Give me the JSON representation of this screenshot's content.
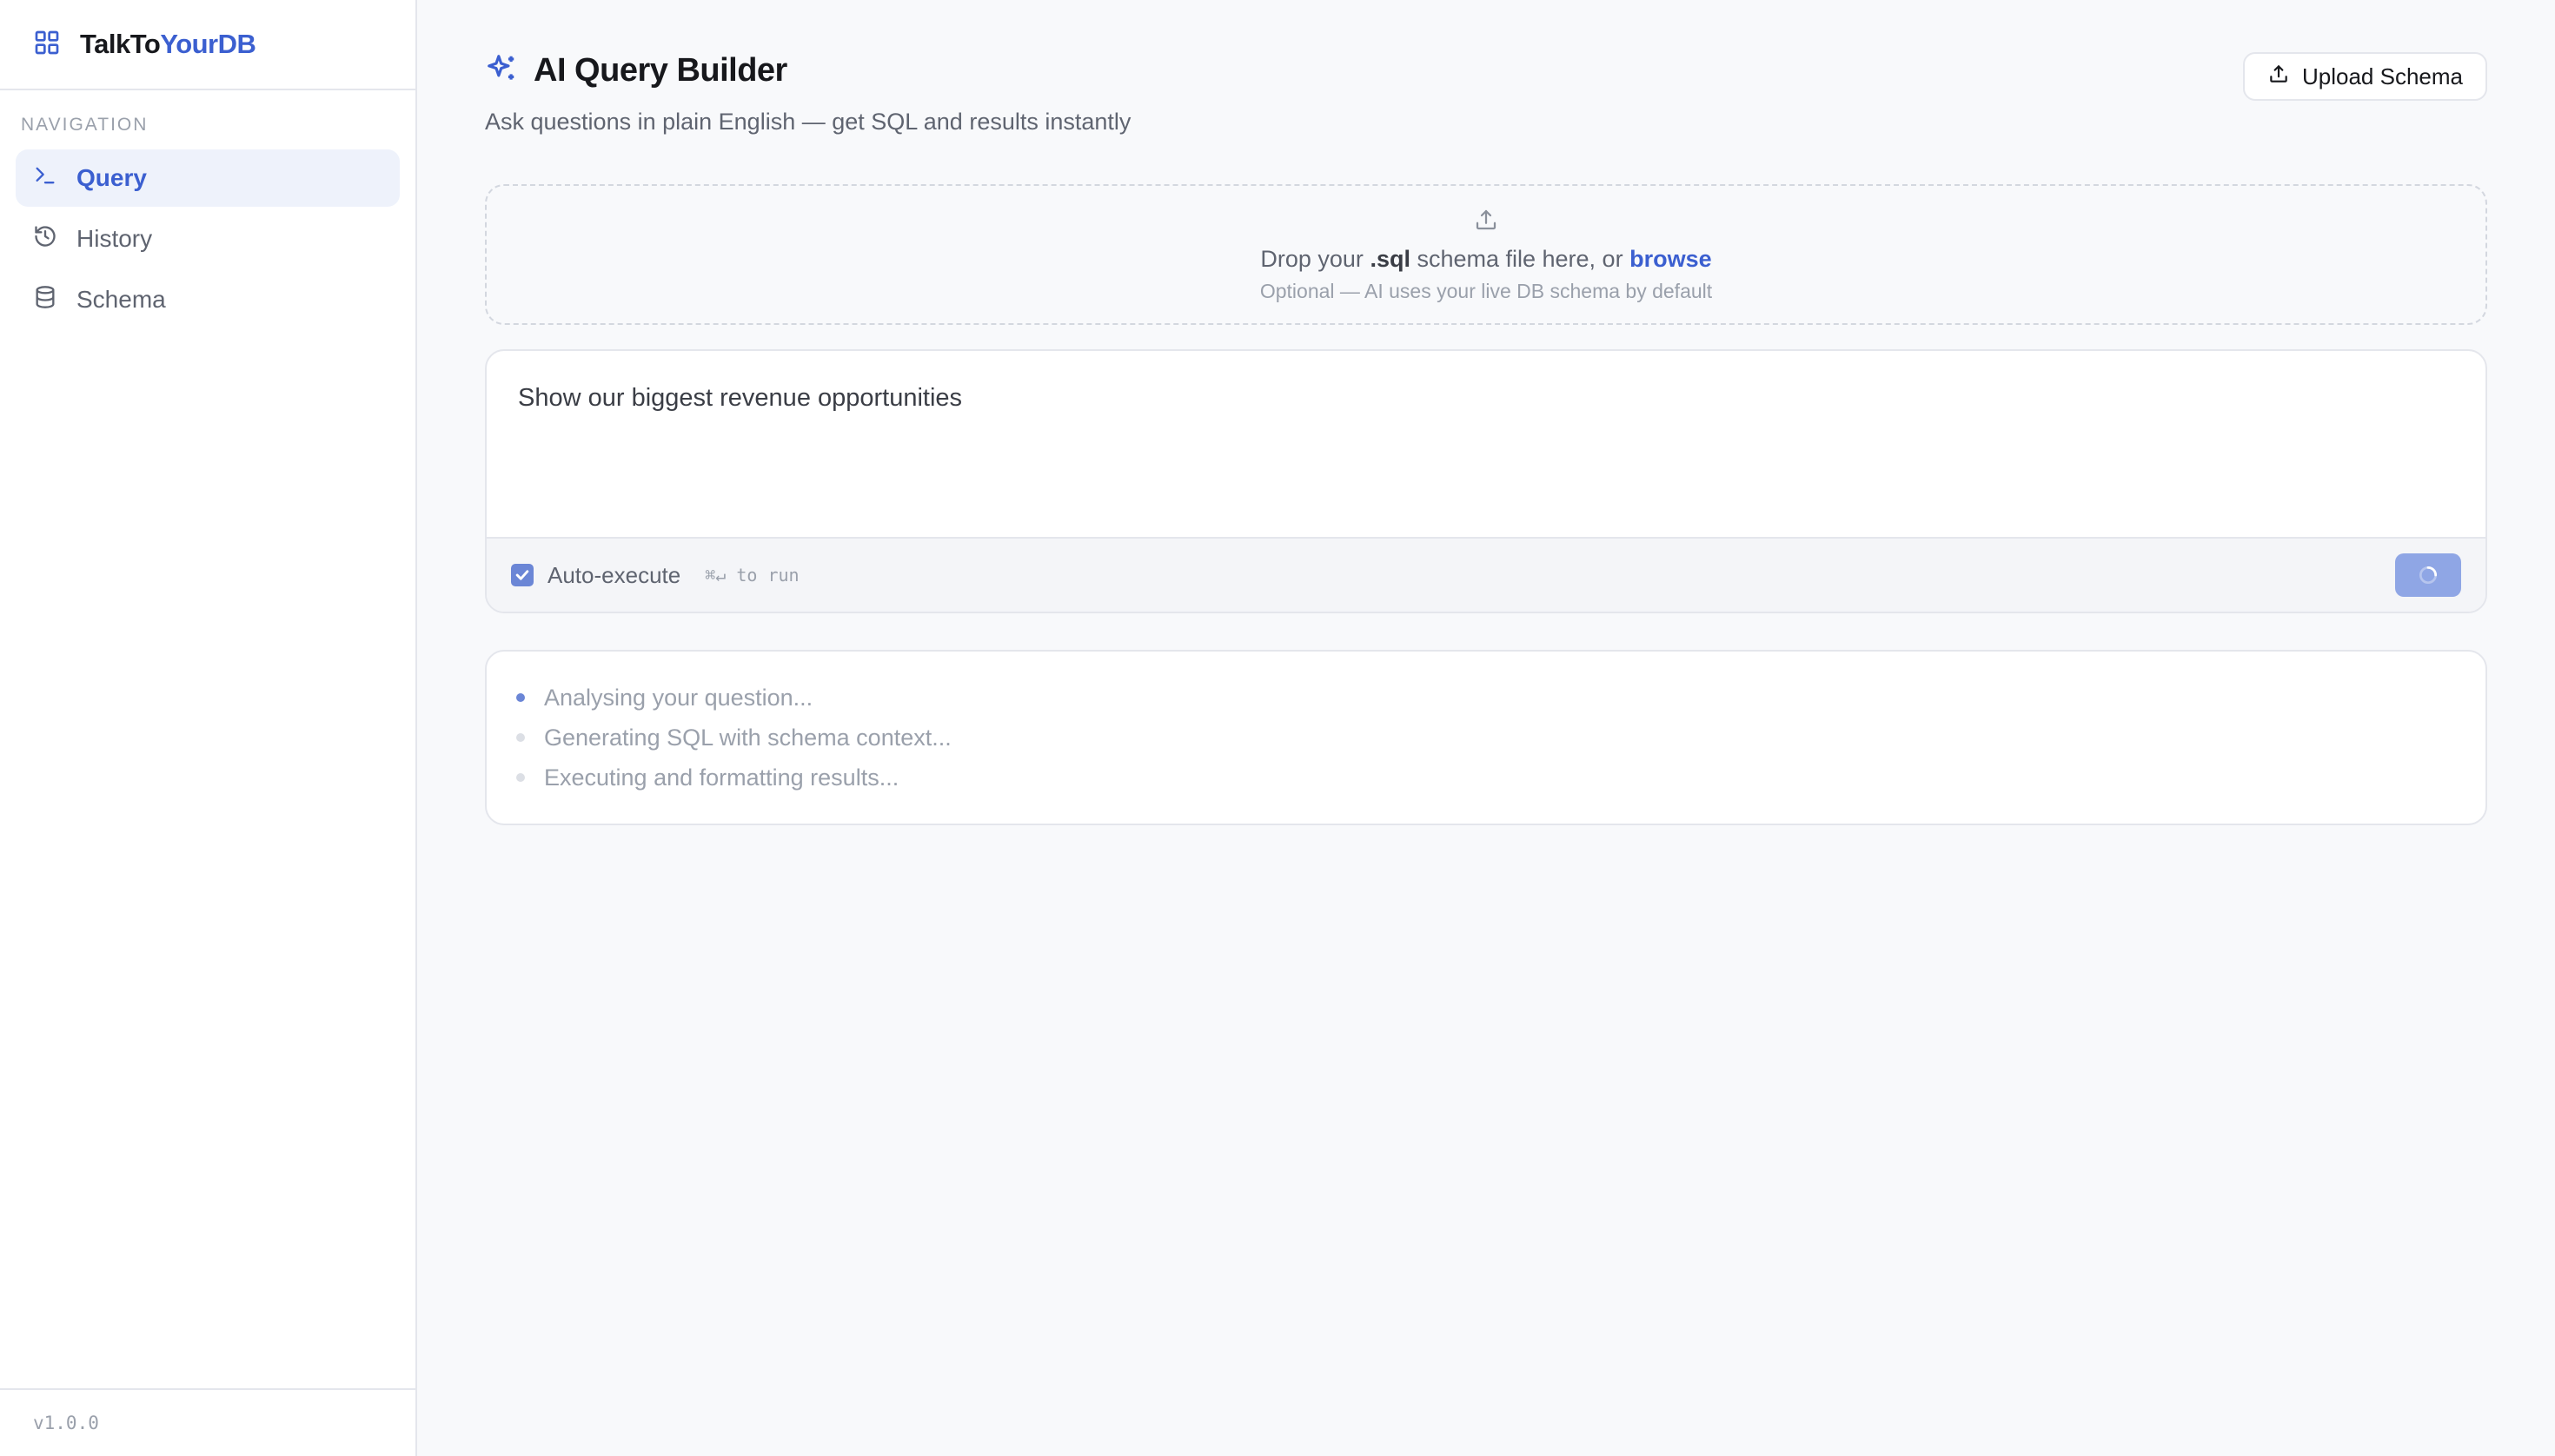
{
  "app": {
    "name_prefix": "TalkTo",
    "name_highlight": "YourDB",
    "version": "v1.0.0"
  },
  "sidebar": {
    "section_label": "NAVIGATION",
    "items": [
      {
        "label": "Query",
        "icon": "terminal-icon",
        "active": true
      },
      {
        "label": "History",
        "icon": "history-icon",
        "active": false
      },
      {
        "label": "Schema",
        "icon": "database-icon",
        "active": false
      }
    ]
  },
  "header": {
    "title": "AI Query Builder",
    "subtitle": "Ask questions in plain English — get SQL and results instantly",
    "upload_label": "Upload Schema"
  },
  "dropzone": {
    "text_before": "Drop your ",
    "ext": ".sql",
    "text_after": " schema file here, or ",
    "link": "browse",
    "hint": "Optional — AI uses your live DB schema by default"
  },
  "query": {
    "value": "Show our biggest revenue opportunities",
    "auto_execute_label": "Auto-execute",
    "auto_execute_checked": true,
    "shortcut": "⌘↵ to run"
  },
  "progress": {
    "steps": [
      {
        "label": "Analysing your question...",
        "active": true
      },
      {
        "label": "Generating SQL with schema context...",
        "active": false
      },
      {
        "label": "Executing and formatting results...",
        "active": false
      }
    ]
  },
  "colors": {
    "accent": "#3b5fd0",
    "accent_soft": "#eef2fb",
    "button_loading": "#8fa6e5"
  }
}
